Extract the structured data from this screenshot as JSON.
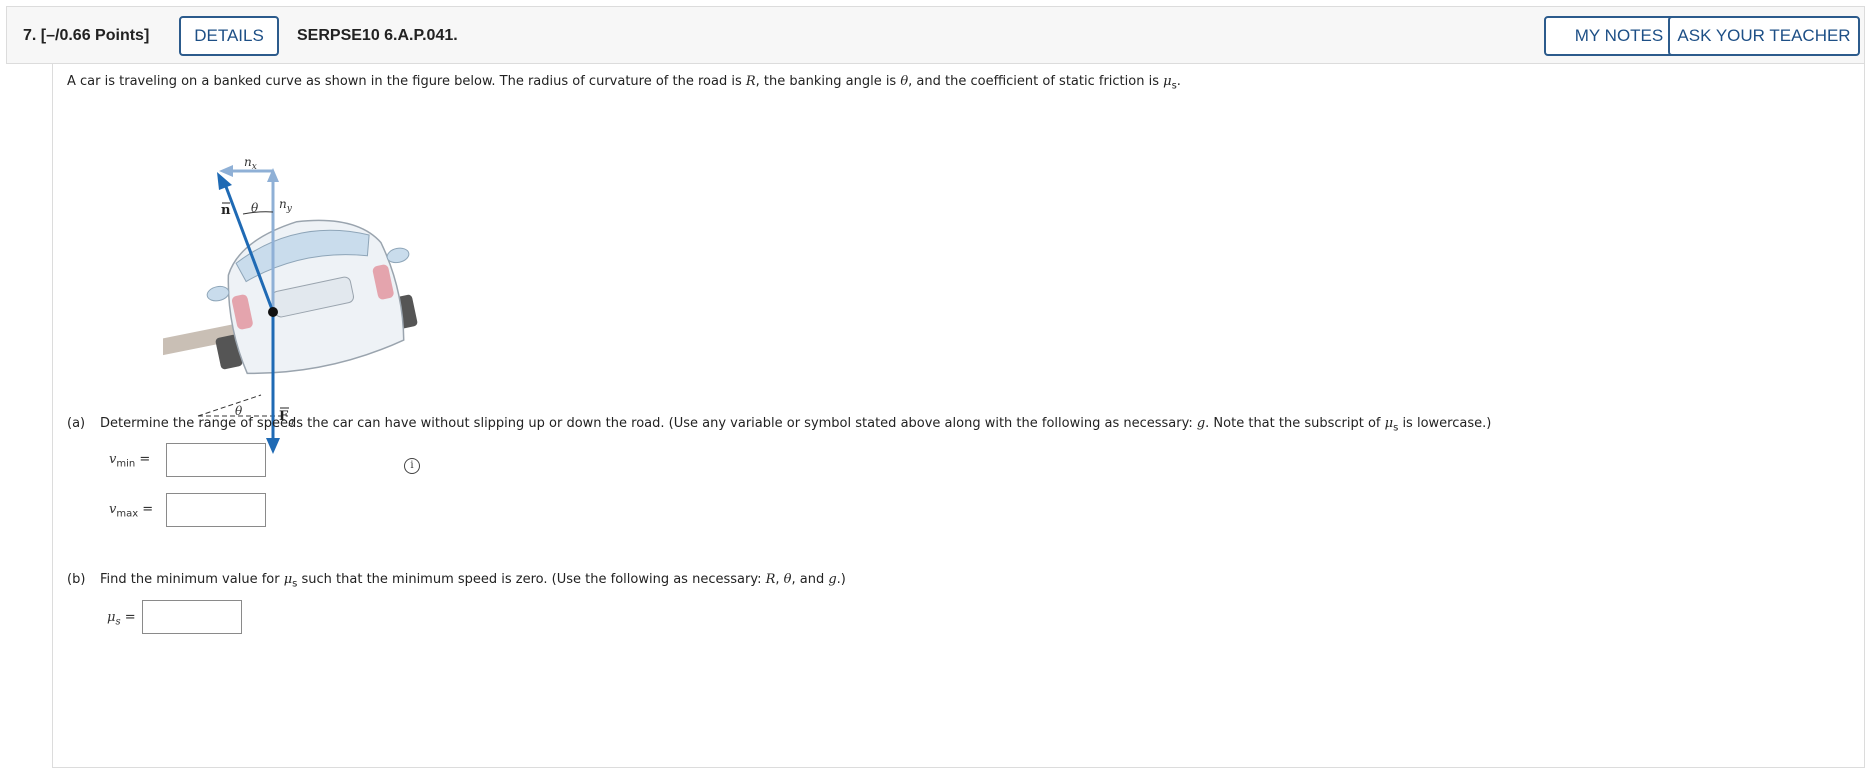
{
  "header": {
    "question_number": "7. [–/0.66 Points]",
    "details_label": "DETAILS",
    "problem_code": "SERPSE10 6.A.P.041.",
    "my_notes_label": "MY NOTES",
    "ask_teacher_label": "ASK YOUR TEACHER",
    "accent_color": "#2c5b8c"
  },
  "problem": {
    "intro_1": "A car is traveling on a banked curve as shown in the figure below. The radius of curvature of the road is ",
    "var_R": "R",
    "intro_2": ", the banking angle is ",
    "var_theta": "θ",
    "intro_3": ", and the coefficient of static friction is ",
    "var_mu": "μ",
    "sub_s": "s",
    "intro_end": "."
  },
  "figure": {
    "label_nx": "n",
    "label_nx_sub": "x",
    "label_ny": "n",
    "label_ny_sub": "y",
    "label_n": "n",
    "label_theta_top": "θ",
    "label_theta_bottom": "θ",
    "label_Fg": "F",
    "label_Fg_sub": "g",
    "arrow_color": "#1f6ab4",
    "arrow_light_color": "#8fb0d6",
    "info_icon": "i"
  },
  "part_a": {
    "letter": "(a)",
    "text_1": "Determine the range of speeds the car can have without slipping up or down the road. (Use any variable or symbol stated above along with the following as necessary: ",
    "var_g": "g",
    "text_2": ". Note that the subscript of ",
    "var_mu": "μ",
    "sub_s": "s",
    "text_3": " is lowercase.)",
    "vmin_var": "v",
    "vmin_sub": "min",
    "vmax_var": "v",
    "vmax_sub": "max",
    "equals": "="
  },
  "part_b": {
    "letter": "(b)",
    "text_1": "Find the minimum value for ",
    "var_mu": "μ",
    "sub_s": "s",
    "text_2": " such that the minimum speed is zero. (Use the following as necessary: ",
    "var_R": "R",
    "sep_1": ", ",
    "var_theta": "θ",
    "sep_2": ", and ",
    "var_g": "g",
    "text_3": ".)",
    "mu_var": "μ",
    "mu_sub": "s",
    "equals": "="
  }
}
